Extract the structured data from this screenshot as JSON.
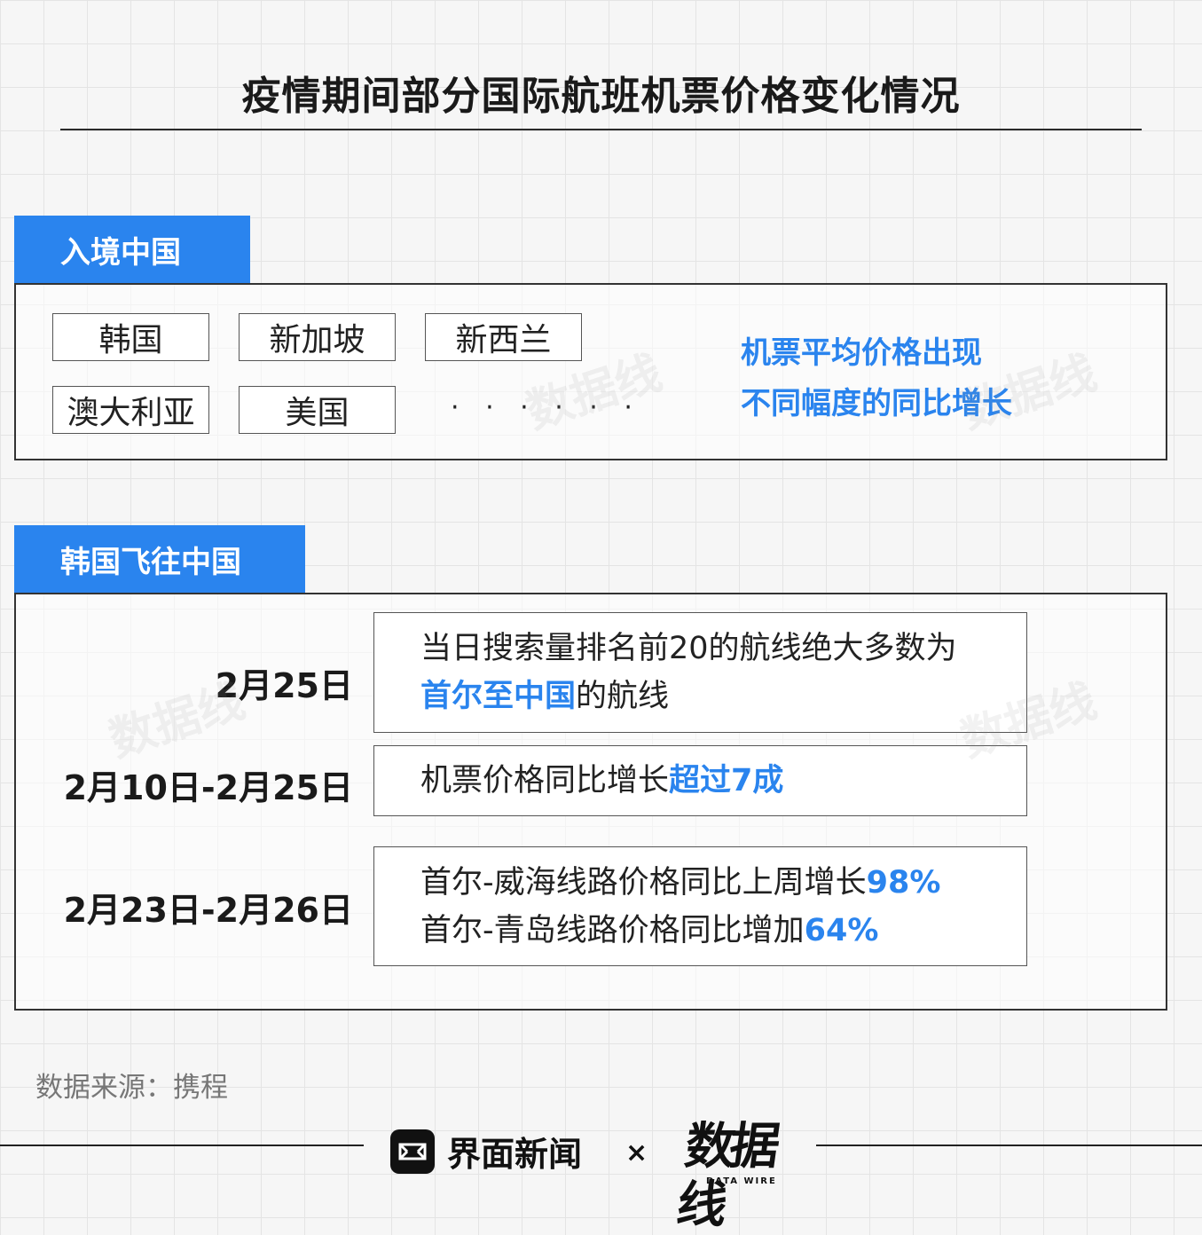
{
  "title": "疫情期间部分国际航班机票价格变化情况",
  "section1": {
    "tag": "入境中国",
    "countries": [
      "韩国",
      "新加坡",
      "新西兰",
      "澳大利亚",
      "美国"
    ],
    "ellipsis": "· · · · · ·",
    "note_line1": "机票平均价格出现",
    "note_line2": "不同幅度的同比增长"
  },
  "section2": {
    "tag": "韩国飞往中国",
    "rows": [
      {
        "date": "2月25日",
        "line1": "当日搜索量排名前20的航线绝大多数为",
        "line2_highlight": "首尔至中国",
        "line2_rest": "的航线"
      },
      {
        "date": "2月10日-2月25日",
        "text": "机票价格同比增长",
        "highlight": "超过7成"
      },
      {
        "date": "2月23日-2月26日",
        "line1_text": "首尔-威海线路价格同比上周增长",
        "line1_highlight": "98%",
        "line2_text": "首尔-青岛线路价格同比增加",
        "line2_highlight": "64%"
      }
    ]
  },
  "source": "数据来源：携程",
  "footer": {
    "brand_name": "界面新闻",
    "separator": "×",
    "partner_logo_text": "数据线",
    "partner_sub": "DATA WIRE"
  },
  "colors": {
    "accent": "#2a84ee",
    "text": "#222222"
  }
}
